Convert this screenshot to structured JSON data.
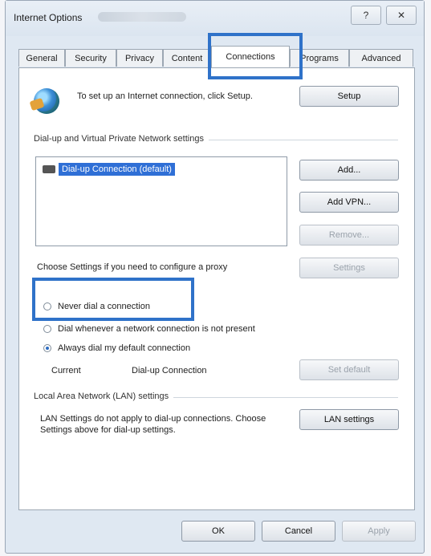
{
  "window": {
    "title": "Internet Options",
    "help_label": "?",
    "close_label": "✕"
  },
  "tabs": [
    {
      "label": "General"
    },
    {
      "label": "Security"
    },
    {
      "label": "Privacy"
    },
    {
      "label": "Content"
    },
    {
      "label": "Connections"
    },
    {
      "label": "Programs"
    },
    {
      "label": "Advanced"
    }
  ],
  "setup": {
    "text": "To set up an Internet connection, click Setup.",
    "button": "Setup"
  },
  "dialup": {
    "section_label": "Dial-up and Virtual Private Network settings",
    "selected_item": "Dial-up Connection (default)",
    "add_button": "Add...",
    "add_vpn_button": "Add VPN...",
    "remove_button": "Remove...",
    "proxy_text": "Choose Settings if you need to configure a proxy",
    "settings_button": "Settings",
    "radio_never": "Never dial a connection",
    "radio_whenever": "Dial whenever a network connection is not present",
    "radio_always": "Always dial my default connection",
    "current_label": "Current",
    "current_value": "Dial-up Connection",
    "set_default_button": "Set default"
  },
  "lan": {
    "section_label": "Local Area Network (LAN) settings",
    "text": "LAN Settings do not apply to dial-up connections. Choose Settings above for dial-up settings.",
    "button": "LAN settings"
  },
  "footer": {
    "ok": "OK",
    "cancel": "Cancel",
    "apply": "Apply"
  },
  "colors": {
    "highlight": "#2f72c9",
    "selection": "#2f6fd6"
  },
  "icons": {
    "setup_icon": "globe-icon",
    "connection_icon": "dialup-phone-icon"
  }
}
